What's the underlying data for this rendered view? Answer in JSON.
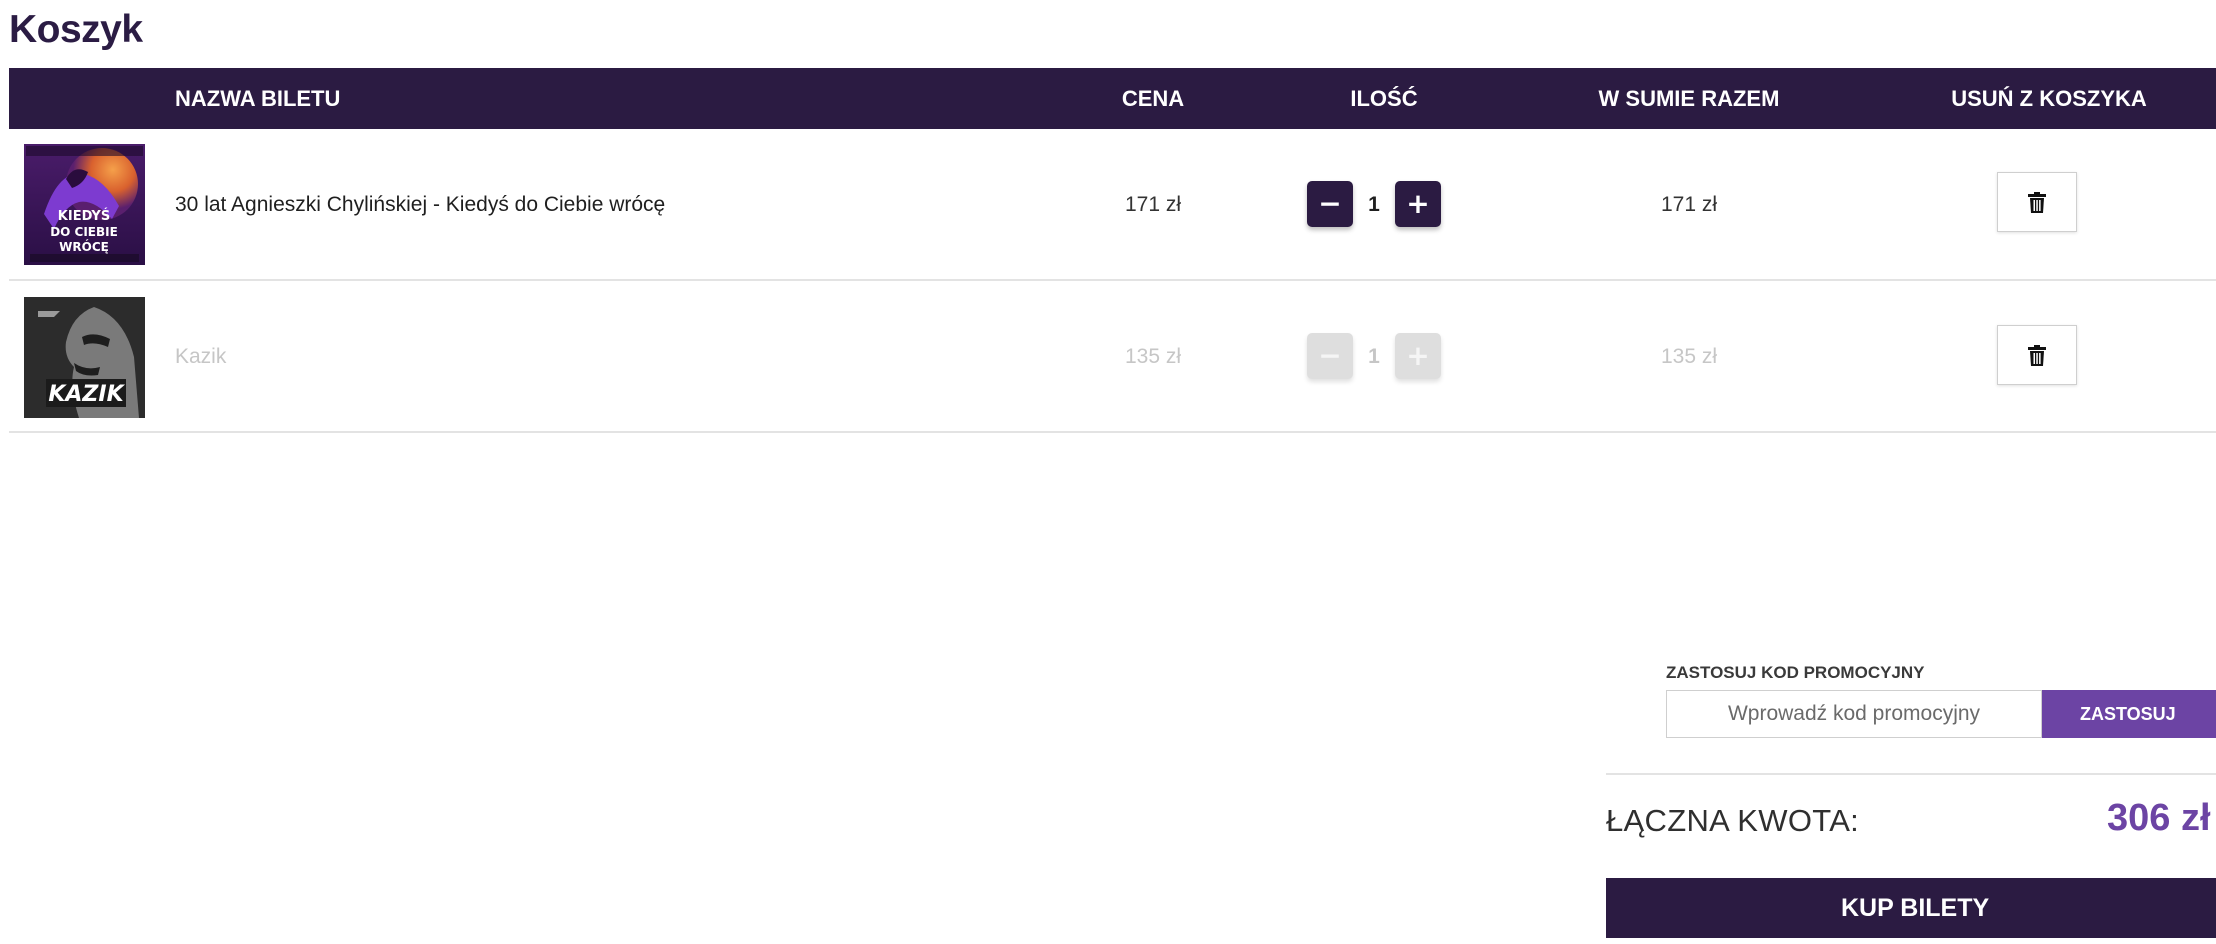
{
  "page": {
    "title": "Koszyk"
  },
  "table": {
    "headers": {
      "name": "NAZWA BILETU",
      "price": "CENA",
      "quantity": "ILOŚĆ",
      "total": "W SUMIE RAZEM",
      "remove": "USUŃ Z KOSZYKA"
    },
    "rows": [
      {
        "thumbnail_text": "KIEDYŚ DO CIEBIE WRÓCĘ",
        "name": "30 lat Agnieszki Chylińskiej - Kiedyś do Ciebie wrócę",
        "price": "171 zł",
        "minus_symbol": "−",
        "quantity": "1",
        "plus_symbol": "+",
        "total": "171 zł",
        "remove_icon": "trash-icon",
        "disabled": false
      },
      {
        "thumbnail_text": "KAZIK",
        "name": "Kazik",
        "price": "135 zł",
        "minus_symbol": "−",
        "quantity": "1",
        "plus_symbol": "+",
        "total": "135 zł",
        "remove_icon": "trash-icon",
        "disabled": true
      }
    ]
  },
  "promo": {
    "label": "ZASTOSUJ KOD PROMOCYJNY",
    "placeholder": "Wprowadź kod promocyjny",
    "apply_label": "ZASTOSUJ"
  },
  "summary": {
    "total_label": "ŁĄCZNA KWOTA:",
    "total_value": "306 zł",
    "buy_label": "KUP BILETY"
  },
  "colors": {
    "primary_dark": "#2b1b42",
    "accent_purple": "#6c44a4",
    "disabled_gray": "#c6c6c6"
  }
}
